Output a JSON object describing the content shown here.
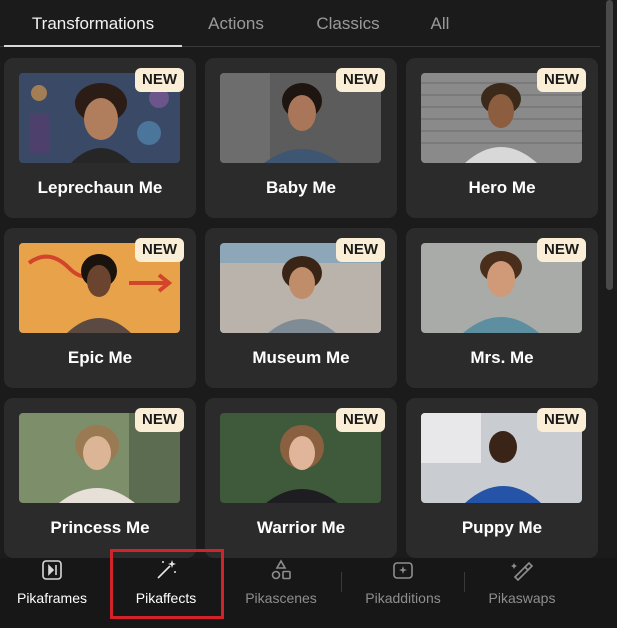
{
  "tabs": [
    {
      "label": "Transformations",
      "active": true
    },
    {
      "label": "Actions",
      "active": false
    },
    {
      "label": "Classics",
      "active": false
    },
    {
      "label": "All",
      "active": false
    }
  ],
  "badge_text": "NEW",
  "cards": [
    {
      "label": "Leprechaun Me"
    },
    {
      "label": "Baby Me"
    },
    {
      "label": "Hero Me"
    },
    {
      "label": "Epic Me"
    },
    {
      "label": "Museum Me"
    },
    {
      "label": "Mrs. Me"
    },
    {
      "label": "Princess Me"
    },
    {
      "label": "Warrior Me"
    },
    {
      "label": "Puppy Me"
    }
  ],
  "bottom_nav": [
    {
      "label": "Pikaframes",
      "icon": "frame-icon",
      "active": true
    },
    {
      "label": "Pikaffects",
      "icon": "magic-wand-icon",
      "active": true
    },
    {
      "label": "Pikascenes",
      "icon": "shapes-icon",
      "active": false
    },
    {
      "label": "Pikadditions",
      "icon": "add-sparkle-icon",
      "active": false
    },
    {
      "label": "Pikaswaps",
      "icon": "brush-swap-icon",
      "active": false
    }
  ],
  "colors": {
    "background": "#1b1b1b",
    "card": "#2b2b2b",
    "badge": "#fbeed6",
    "highlight": "#d3232a"
  }
}
